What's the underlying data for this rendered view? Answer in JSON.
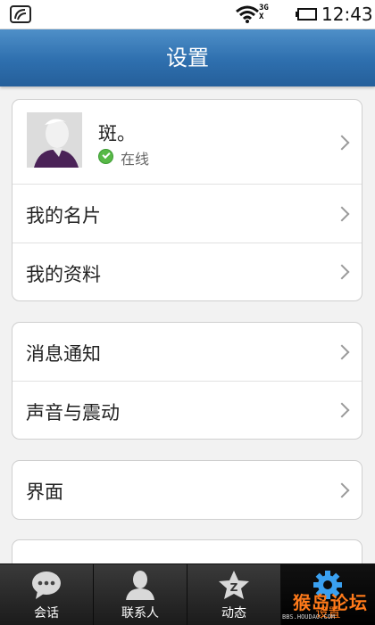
{
  "status_bar": {
    "time": "12:43",
    "network_top": "3G",
    "network_bottom": "X"
  },
  "header": {
    "title": "设置"
  },
  "profile": {
    "name": "斑。",
    "status": "在线"
  },
  "group1": {
    "items": [
      {
        "label": "我的名片"
      },
      {
        "label": "我的资料"
      }
    ]
  },
  "group2": {
    "items": [
      {
        "label": "消息通知"
      },
      {
        "label": "声音与震动"
      }
    ]
  },
  "group3": {
    "items": [
      {
        "label": "界面"
      }
    ]
  },
  "tabs": [
    {
      "label": "会话",
      "icon": "chat-bubble-icon"
    },
    {
      "label": "联系人",
      "icon": "person-icon"
    },
    {
      "label": "动态",
      "icon": "star-icon"
    },
    {
      "label": "设置",
      "icon": "gear-icon",
      "active": true
    }
  ],
  "watermark": {
    "text": "猴岛论坛",
    "site": "BBS.HOUDAO.COM"
  },
  "colors": {
    "header": "#2e6fae",
    "online": "#58b947",
    "tabbar": "#1b1b1b"
  }
}
